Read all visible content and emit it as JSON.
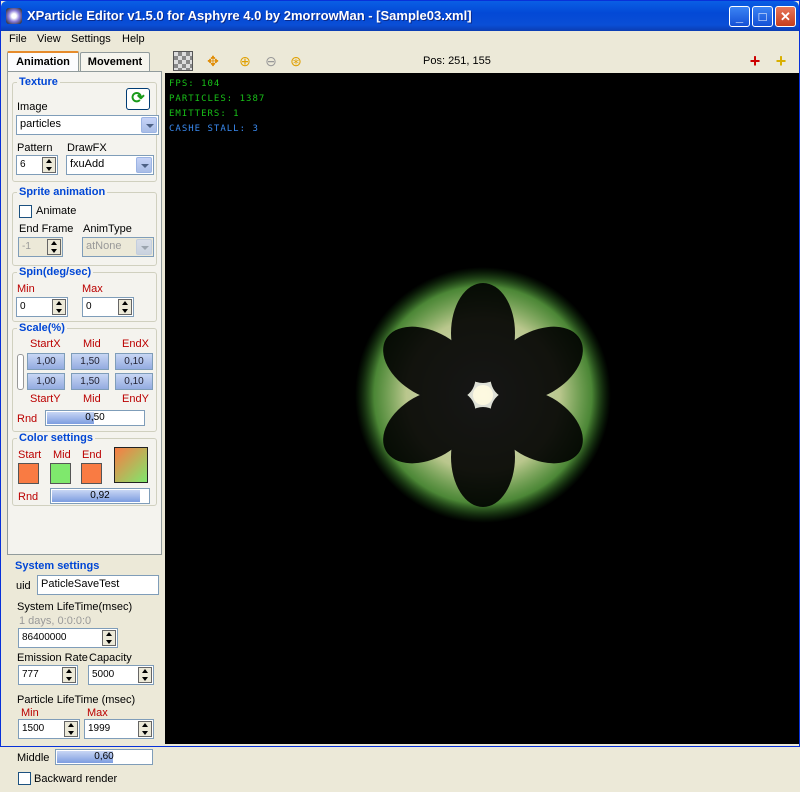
{
  "window": {
    "title": "XParticle Editor v1.5.0 for Asphyre 4.0 by 2morrowMan - [Sample03.xml]"
  },
  "menu": [
    "File",
    "View",
    "Settings",
    "Help"
  ],
  "tabs": {
    "animation": "Animation",
    "movement": "Movement"
  },
  "texture": {
    "title": "Texture",
    "image_label": "Image",
    "image_value": "particles",
    "pattern_label": "Pattern",
    "pattern_value": "6",
    "drawfx_label": "DrawFX",
    "drawfx_value": "fxuAdd"
  },
  "sprite": {
    "title": "Sprite animation",
    "animate_label": "Animate",
    "end_frame_label": "End Frame",
    "end_frame_value": "-1",
    "animtype_label": "AnimType",
    "animtype_value": "atNone"
  },
  "spin": {
    "title": "Spin(deg/sec)",
    "min_label": "Min",
    "min_value": "0",
    "max_label": "Max",
    "max_value": "0"
  },
  "scale": {
    "title": "Scale(%)",
    "startx": "StartX",
    "mid": "Mid",
    "endx": "EndX",
    "starty": "StartY",
    "endy": "EndY",
    "row1": [
      "1,00",
      "1,50",
      "0,10"
    ],
    "row2": [
      "1,00",
      "1,50",
      "0,10"
    ],
    "rnd_label": "Rnd",
    "rnd_value": "0,50",
    "rnd_fraction": 0.5
  },
  "color": {
    "title": "Color settings",
    "start": "Start",
    "mid": "Mid",
    "end": "End",
    "start_color": "#f97b43",
    "mid_color": "#7fe86d",
    "end_color": "#f97b43",
    "rnd_label": "Rnd",
    "rnd_value": "0,92",
    "rnd_fraction": 0.92
  },
  "system": {
    "title": "System settings",
    "uid_label": "uid",
    "uid_value": "PaticleSaveTest",
    "lifetime_label": "System LifeTime(msec)",
    "lifetime_readable": "1 days, 0:0:0:0",
    "lifetime_value": "86400000",
    "emission_label": "Emission Rate",
    "emission_value": "777",
    "capacity_label": "Capacity",
    "capacity_value": "5000",
    "plife_label": "Particle LifeTime (msec)",
    "plife_min_label": "Min",
    "plife_min_value": "1500",
    "plife_max_label": "Max",
    "plife_max_value": "1999",
    "middle_label": "Middle",
    "middle_value": "0,60",
    "middle_fraction": 0.6,
    "backward_label": "Backward render"
  },
  "toolbar": {
    "pos": "Pos: 251, 155"
  },
  "stats": {
    "fps": "FPS: 104",
    "particles": "PARTICLES: 1387",
    "emitters": "EMITTERS: 1",
    "cache": "CASHE STALL: 3"
  }
}
